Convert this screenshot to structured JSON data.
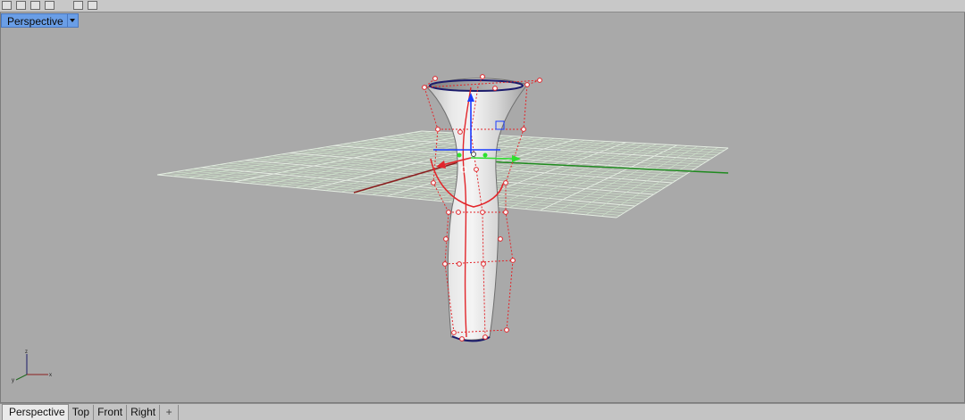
{
  "viewport": {
    "title": "Perspective",
    "menu_icon": "chevron-down-icon"
  },
  "tabs": [
    {
      "label": "Perspective",
      "active": true
    },
    {
      "label": "Top",
      "active": false
    },
    {
      "label": "Front",
      "active": false
    },
    {
      "label": "Right",
      "active": false
    }
  ],
  "add_tab_icon": "plus-icon",
  "axis_icon": "world-axis-icon",
  "colors": {
    "background": "#a9a9a9",
    "grid": "#cfe3cc",
    "x_axis": "#8b1e1e",
    "y_axis": "#1f8a1f",
    "gumball_z": "#1a3cff",
    "control_points": "#e2262b",
    "viewport_label_bg": "#6a9ee6"
  }
}
